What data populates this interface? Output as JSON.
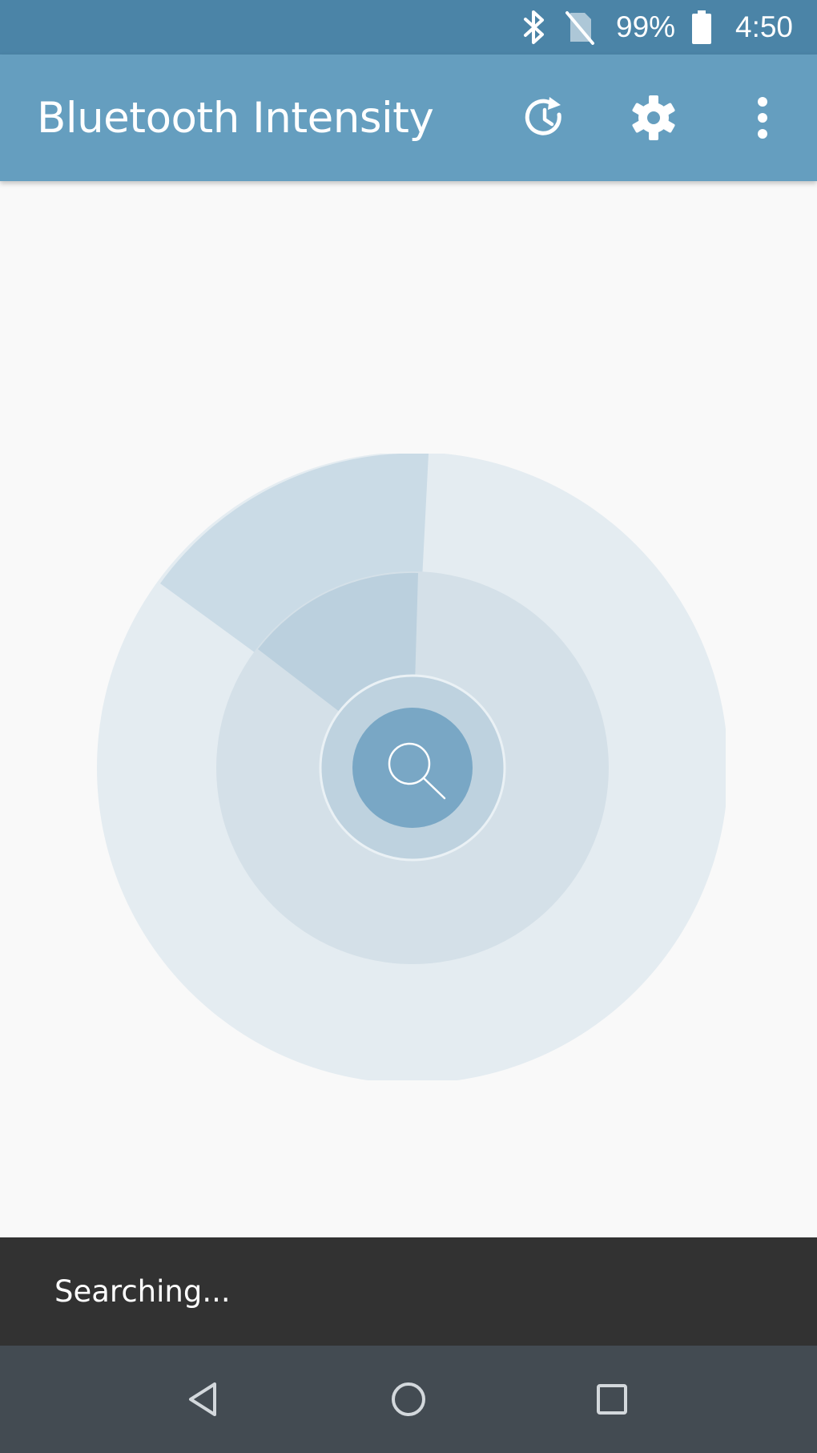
{
  "status_bar": {
    "battery_percent": "99%",
    "time": "4:50",
    "icons": [
      "bluetooth-icon",
      "no-sim-icon",
      "battery-icon"
    ]
  },
  "app_bar": {
    "title": "Bluetooth Intensity",
    "actions": [
      "history-icon",
      "settings-gear-icon",
      "more-vert-icon"
    ]
  },
  "radar": {
    "center_icon": "search-icon",
    "colors": {
      "outer_ring": "#e4ecf1",
      "middle_ring": "#d4e0e8",
      "sweep": "#b3cbdb",
      "inner_ring": "#bed2df",
      "center": "#79a7c5"
    }
  },
  "snackbar": {
    "text": "Searching..."
  },
  "nav_bar": {
    "buttons": [
      "back-icon",
      "home-icon",
      "recents-icon"
    ]
  },
  "colors": {
    "status_bar": "#4b84a7",
    "app_bar": "#659ebf",
    "background": "#f9f9f9",
    "snackbar": "#323232",
    "nav_bar": "#434b52"
  }
}
